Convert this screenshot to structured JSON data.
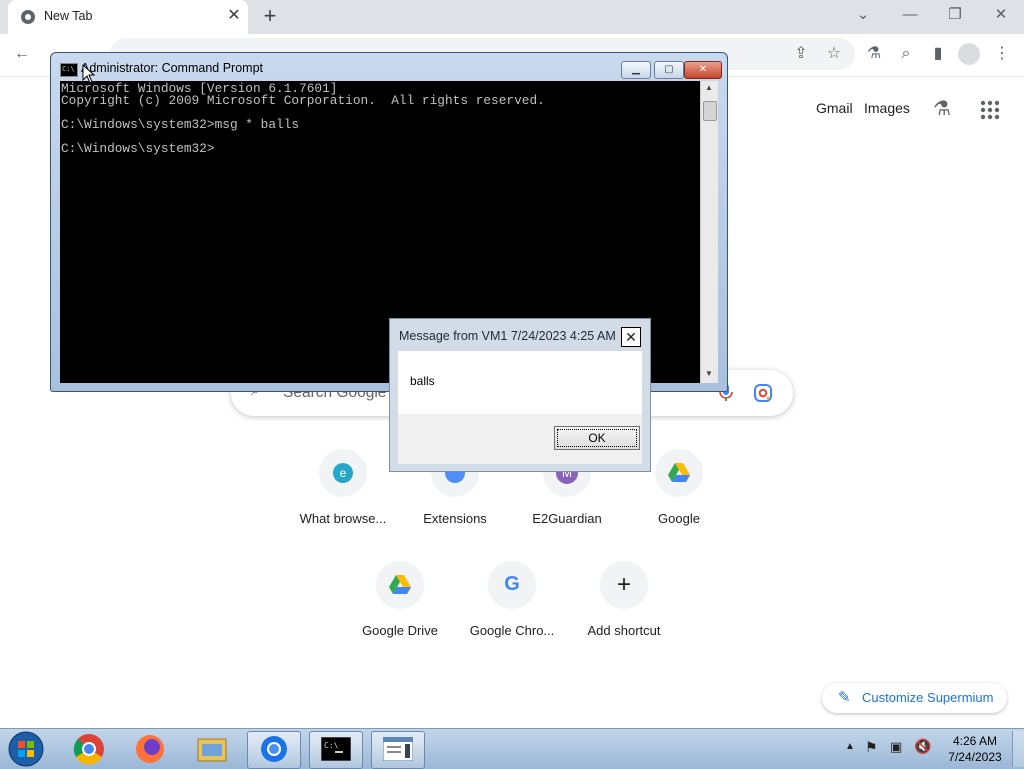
{
  "browser": {
    "tab_title": "New Tab",
    "colors": {
      "accent": "#1a73e8",
      "tabstrip": "#dee1e6"
    }
  },
  "ntp": {
    "links": {
      "gmail": "Gmail",
      "images": "Images"
    },
    "search_placeholder": "Search Google",
    "shortcuts": [
      {
        "label": "What browse...",
        "icon": "globe-icon"
      },
      {
        "label": "Extensions",
        "icon": "extensions-icon"
      },
      {
        "label": "E2Guardian",
        "icon": "letter-m-icon"
      },
      {
        "label": "Google",
        "icon": "google-drive-icon"
      },
      {
        "label": "Google Drive",
        "icon": "google-drive-icon"
      },
      {
        "label": "Google Chro...",
        "icon": "google-g-icon"
      },
      {
        "label": "Add shortcut",
        "icon": "plus-icon"
      }
    ],
    "customize_label": "Customize Supermium"
  },
  "cmd": {
    "title": "Administrator: Command Prompt",
    "lines": [
      "Microsoft Windows [Version 6.1.7601]",
      "Copyright (c) 2009 Microsoft Corporation.  All rights reserved.",
      "",
      "C:\\Windows\\system32>msg * balls",
      "",
      "C:\\Windows\\system32>"
    ]
  },
  "message_box": {
    "title": "Message from VM1 7/24/2023 4:25 AM",
    "body": "balls",
    "ok_label": "OK"
  },
  "taskbar": {
    "time": "4:26 AM",
    "date": "7/24/2023"
  }
}
